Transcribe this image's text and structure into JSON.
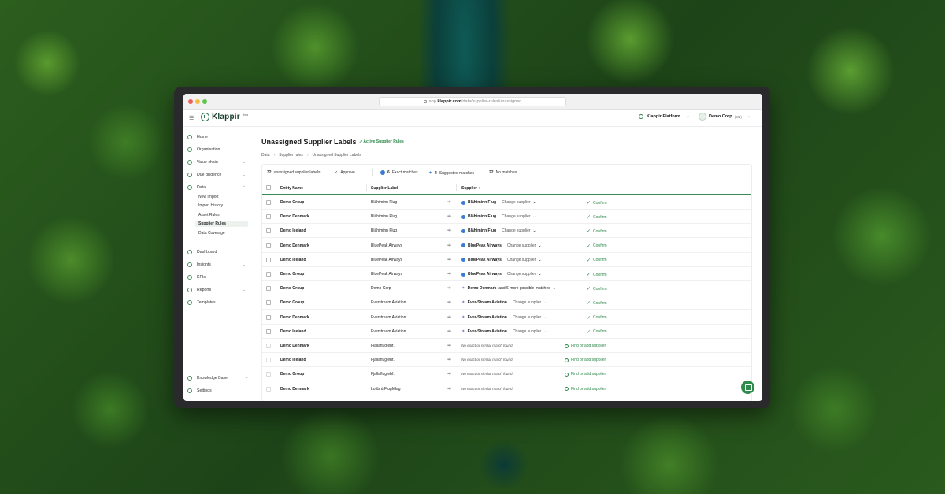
{
  "browser": {
    "url_prefix": "app.",
    "url_domain": "klappir.com",
    "url_path": "/data/supplier-rules/unassigned"
  },
  "topbar": {
    "logo_text": "Klappir",
    "logo_sup": "Beta",
    "platform": "Klappir Platform",
    "org_name": "Demo Corp",
    "org_code": "(EN)"
  },
  "sidebar": {
    "home": "Home",
    "organisation": "Organisation",
    "value_chain": "Value chain",
    "due_diligence": "Due diligence",
    "data": "Data",
    "data_sub": [
      "New Import",
      "Import History",
      "Asset Rules",
      "Supplier Rules",
      "Data Coverage"
    ],
    "dashboard": "Dashboard",
    "insights": "Insights",
    "kpis": "KPIs",
    "reports": "Reports",
    "templates": "Templates",
    "knowledge_base": "Knowledge Base",
    "settings": "Settings"
  },
  "page": {
    "title": "Unassigned Supplier Labels",
    "active_rules": "Active Supplier Rules",
    "crumbs": [
      "Data",
      "Supplier rules",
      "Unassigned Supplier Labels"
    ]
  },
  "toolbar": {
    "count": "32",
    "count_label": "unassigned supplier labels",
    "approve": "Approve",
    "exact_count": "6",
    "exact_label": "Exact matches",
    "suggested_count": "4",
    "suggested_label": "Suggested matches",
    "none_count": "22",
    "none_label": "No matches"
  },
  "table": {
    "headers": {
      "entity": "Entity Name",
      "label": "Supplier Label",
      "supplier": "Supplier"
    },
    "change_supplier": "Change supplier",
    "confirm": "Confirm",
    "find_add": "Find or add supplier",
    "no_match": "No exact or similar match found.",
    "rows": [
      {
        "entity": "Demo Group",
        "label": "Blähiminn Flug",
        "supplier": "Blähiminn Flug",
        "type": "exact"
      },
      {
        "entity": "Demo Denmark",
        "label": "Blähiminn Flug",
        "supplier": "Blähiminn Flug",
        "type": "exact"
      },
      {
        "entity": "Demo Iceland",
        "label": "Blähiminn Flug",
        "supplier": "Blähiminn Flug",
        "type": "exact"
      },
      {
        "entity": "Demo Denmark",
        "label": "BluePeak Airways",
        "supplier": "BluePeak Airways",
        "type": "exact"
      },
      {
        "entity": "Demo Iceland",
        "label": "BluePeak Airways",
        "supplier": "BluePeak Airways",
        "type": "exact"
      },
      {
        "entity": "Demo Group",
        "label": "BluePeak Airways",
        "supplier": "BluePeak Airways",
        "type": "exact"
      },
      {
        "entity": "Demo Group",
        "label": "Demo Corp",
        "supplier": "Demo Denmark",
        "extra": "and 6 more possible matches",
        "type": "suggested"
      },
      {
        "entity": "Demo Group",
        "label": "Everstream Aviation",
        "supplier": "Ever-Stream Aviation",
        "type": "suggested"
      },
      {
        "entity": "Demo Denmark",
        "label": "Everstream Aviation",
        "supplier": "Ever-Stream Aviation",
        "type": "suggested"
      },
      {
        "entity": "Demo Iceland",
        "label": "Everstream Aviation",
        "supplier": "Ever-Stream Aviation",
        "type": "suggested"
      },
      {
        "entity": "Demo Denmark",
        "label": "Fjallaflug ehf.",
        "type": "none"
      },
      {
        "entity": "Demo Iceland",
        "label": "Fjallaflug ehf.",
        "type": "none"
      },
      {
        "entity": "Demo Group",
        "label": "Fjallaflug ehf.",
        "type": "none"
      },
      {
        "entity": "Demo Denmark",
        "label": "Loftbrú Flugfélag",
        "type": "none"
      }
    ]
  },
  "colors": {
    "accent": "#2f8a4c",
    "exact": "#3b7bd6"
  }
}
